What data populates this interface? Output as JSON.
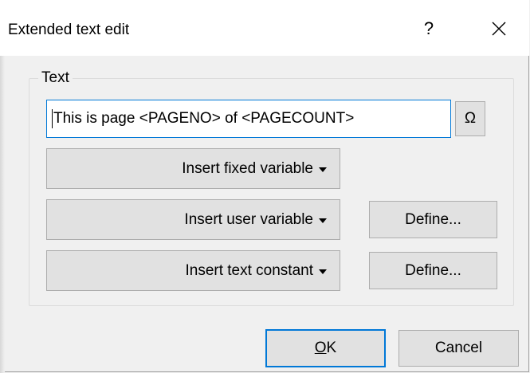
{
  "dialog": {
    "title": "Extended text edit",
    "help_label": "?",
    "close_icon": "close-icon"
  },
  "text_group": {
    "label": "Text",
    "input_value": "This is page <PAGENO> of <PAGECOUNT>",
    "special_char_label": "Ω"
  },
  "buttons": {
    "insert_fixed": "Insert fixed variable",
    "insert_user": "Insert user variable",
    "insert_constant": "Insert text constant",
    "define_user": "Define...",
    "define_constant": "Define...",
    "ok": "OK",
    "cancel": "Cancel"
  },
  "colors": {
    "focus_accent": "#0078d7",
    "button_face": "#e1e1e1",
    "dialog_background": "#f0f0f0"
  }
}
